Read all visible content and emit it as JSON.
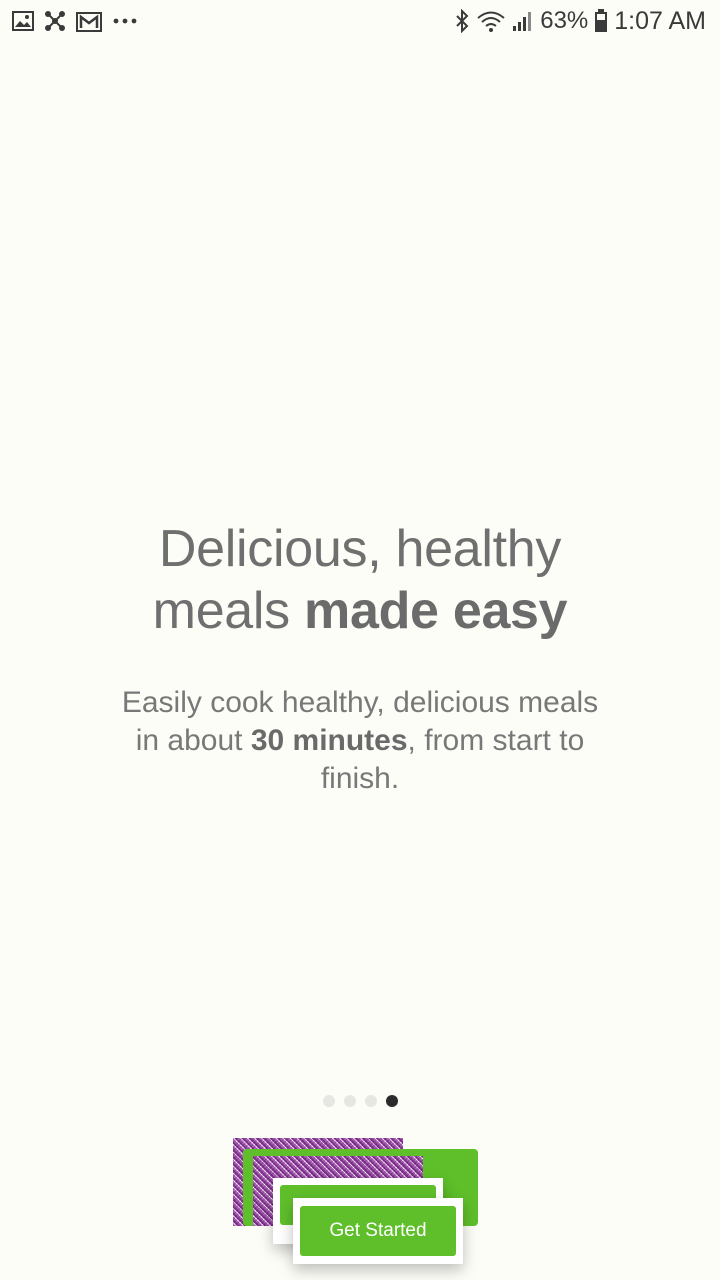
{
  "status_bar": {
    "left_icons": [
      "gallery-icon",
      "network-icon",
      "gmail-icon",
      "more-dots-icon"
    ],
    "right_icons": [
      "bluetooth-icon",
      "wifi-icon",
      "signal-icon",
      "battery-icon"
    ],
    "battery": "63%",
    "time": "1:07 AM"
  },
  "headline": {
    "line1": "Delicious, healthy",
    "line2_prefix": "meals ",
    "line2_bold": "made easy"
  },
  "subtext": {
    "part1": "Easily cook healthy, delicious meals in about ",
    "bold": "30 minutes",
    "part2": ", from start to finish."
  },
  "pager": {
    "total": 4,
    "active_index": 3
  },
  "cta": {
    "label": "Get Started"
  },
  "colors": {
    "accent": "#5fbf2a",
    "background": "#fdfdf8"
  }
}
